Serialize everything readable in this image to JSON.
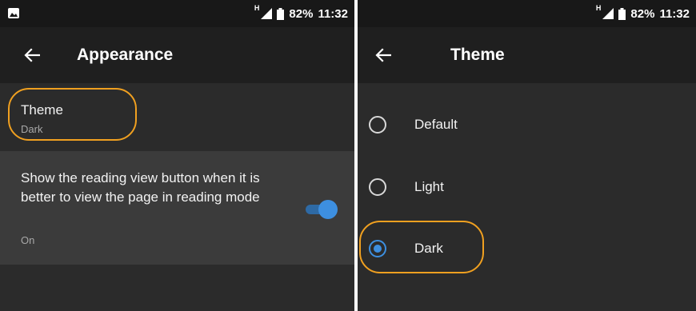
{
  "colors": {
    "background": "#2b2b2b",
    "statusbar": "#181818",
    "appbar": "#1f1f1f",
    "highlighted_row": "#3b3b3b",
    "accent": "#3d8fe0",
    "annotation": "#f0a020"
  },
  "left": {
    "status": {
      "notification_icon": "image-icon",
      "network_type": "H",
      "battery": "82%",
      "time": "11:32"
    },
    "appbar": {
      "back_icon": "arrow-left-icon",
      "title": "Appearance"
    },
    "theme_pref": {
      "title": "Theme",
      "summary": "Dark"
    },
    "reading_pref": {
      "title": "Show the reading view button when it is better to view the page in reading mode",
      "summary": "On",
      "enabled": true
    }
  },
  "right": {
    "status": {
      "network_type": "H",
      "battery": "82%",
      "time": "11:32"
    },
    "appbar": {
      "back_icon": "arrow-left-icon",
      "title": "Theme"
    },
    "options": [
      {
        "label": "Default",
        "selected": false
      },
      {
        "label": "Light",
        "selected": false
      },
      {
        "label": "Dark",
        "selected": true
      }
    ]
  }
}
